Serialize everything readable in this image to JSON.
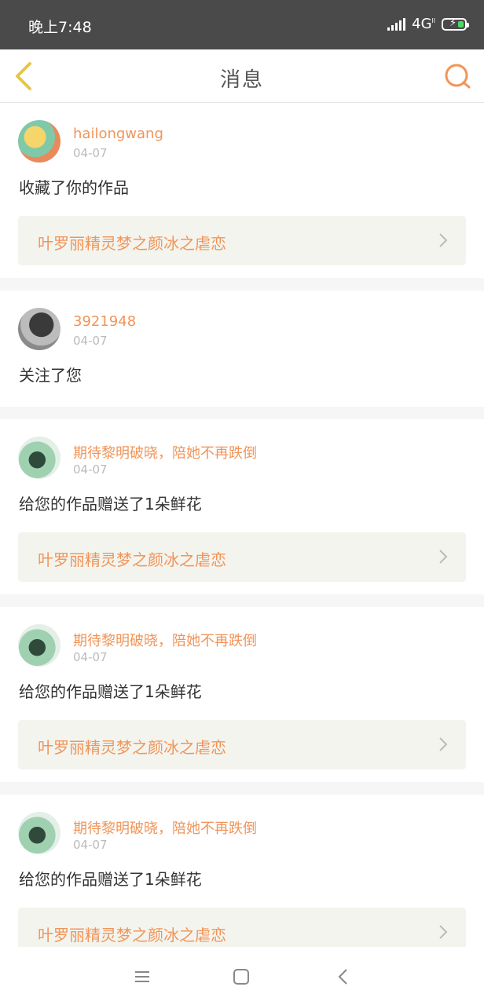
{
  "status": {
    "time": "晚上7:48",
    "network": "4G",
    "network_sup": "ll"
  },
  "header": {
    "title": "消息"
  },
  "messages": [
    {
      "user": "hailongwang",
      "date": "04-07",
      "action": "收藏了你的作品",
      "work": "叶罗丽精灵梦之颜冰之虐恋"
    },
    {
      "user": "3921948",
      "date": "04-07",
      "action": "关注了您"
    },
    {
      "user": "期待黎明破晓，陪她不再跌倒",
      "date": "04-07",
      "action": "给您的作品赠送了1朵鲜花",
      "work": "叶罗丽精灵梦之颜冰之虐恋"
    },
    {
      "user": "期待黎明破晓，陪她不再跌倒",
      "date": "04-07",
      "action": "给您的作品赠送了1朵鲜花",
      "work": "叶罗丽精灵梦之颜冰之虐恋"
    },
    {
      "user": "期待黎明破晓，陪她不再跌倒",
      "date": "04-07",
      "action": "给您的作品赠送了1朵鲜花",
      "work": "叶罗丽精灵梦之颜冰之虐恋"
    }
  ],
  "colors": {
    "accent": "#f0955a",
    "back_icon": "#e6c64a",
    "status_bar": "#4a4a4a"
  }
}
